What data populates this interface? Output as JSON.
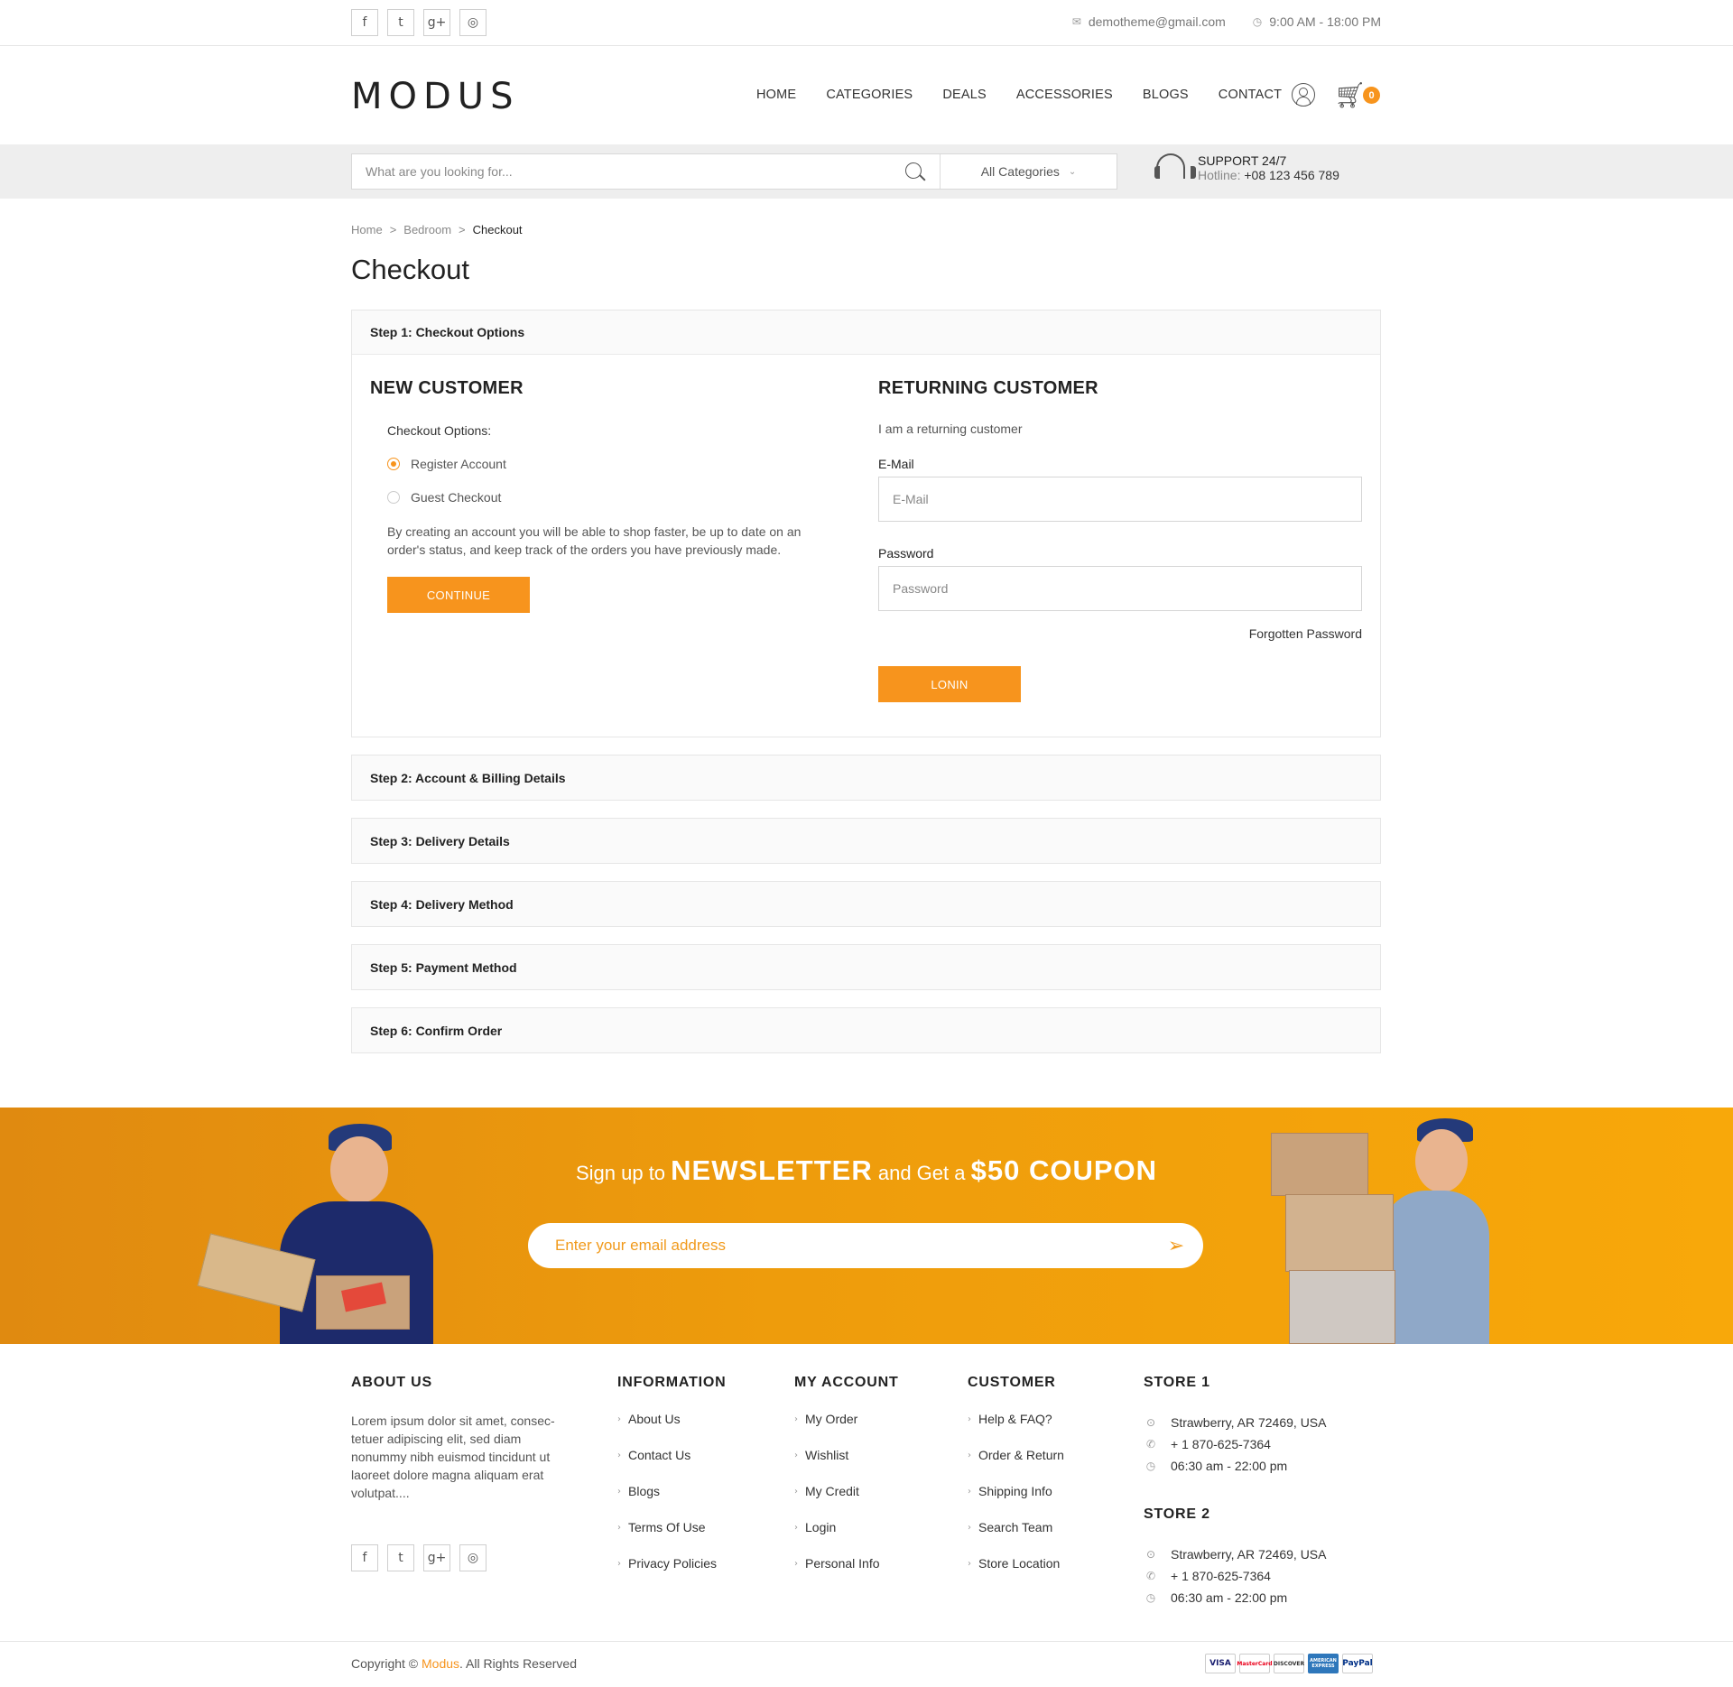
{
  "topbar": {
    "social_icons": [
      "f",
      "t",
      "g+",
      "◎"
    ],
    "email": "demotheme@gmail.com",
    "hours": "9:00 AM - 18:00 PM"
  },
  "header": {
    "logo": "MODUS",
    "nav": [
      "HOME",
      "CATEGORIES",
      "DEALS",
      "ACCESSORIES",
      "BLOGS",
      "CONTACT"
    ],
    "cart_count": "0"
  },
  "search": {
    "placeholder": "What are you looking for...",
    "category": "All Categories",
    "support_title": "SUPPORT 24/7",
    "hotline_label": "Hotline:",
    "hotline": "+08 123 456 789"
  },
  "breadcrumb": [
    "Home",
    "Bedroom",
    "Checkout"
  ],
  "page_title": "Checkout",
  "steps": [
    "Step 1: Checkout Options",
    "Step 2: Account & Billing Details",
    "Step 3: Delivery Details",
    "Step 4: Delivery Method",
    "Step 5: Payment Method",
    "Step 6: Confirm Order"
  ],
  "new_customer": {
    "title": "NEW CUSTOMER",
    "options_label": "Checkout Options:",
    "option_register": "Register Account",
    "option_guest": "Guest Checkout",
    "selected": "Register Account",
    "description": "By creating an account you will be able to shop faster, be up to date on an order's status, and keep track of the orders you have previously made.",
    "button": "CONTINUE"
  },
  "returning_customer": {
    "title": "RETURNING CUSTOMER",
    "subtitle": "I am a returning customer",
    "email_label": "E-Mail",
    "email_placeholder": "E-Mail",
    "password_label": "Password",
    "password_placeholder": "Password",
    "forgot": "Forgotten Password",
    "button": "LONIN"
  },
  "newsletter": {
    "pre": "Sign up to",
    "highlight1": "NEWSLETTER",
    "mid": "and Get a",
    "highlight2": "$50 COUPON",
    "placeholder": "Enter your email address"
  },
  "footer": {
    "about_title": "ABOUT US",
    "about_text": "Lorem ipsum dolor sit amet, consec-tetuer adipiscing elit, sed diam nonummy nibh euismod tincidunt ut laoreet dolore magna aliquam erat volutpat....",
    "information_title": "INFORMATION",
    "information": [
      "About Us",
      "Contact Us",
      "Blogs",
      "Terms Of Use",
      "Privacy Policies"
    ],
    "account_title": "MY ACCOUNT",
    "account": [
      "My Order",
      "Wishlist",
      "My Credit",
      "Login",
      "Personal Info"
    ],
    "customer_title": "CUSTOMER",
    "customer": [
      "Help & FAQ?",
      "Order & Return",
      "Shipping Info",
      "Search Team",
      "Store Location"
    ],
    "store1_title": "STORE 1",
    "store2_title": "STORE 2",
    "store_address": "Strawberry, AR 72469, USA",
    "store_phone": "+ 1 870-625-7364",
    "store_hours": "06:30 am - 22:00 pm",
    "copyright_pre": "Copyright ©",
    "copyright_brand": "Modus",
    "copyright_post": ". All Rights Reserved",
    "payment_cards": [
      "VISA",
      "MasterCard",
      "DISCOVER",
      "AMERICAN EXPRESS",
      "PayPal"
    ]
  },
  "colors": {
    "accent": "#f7941d",
    "newsletter_start": "#e08a10",
    "newsletter_end": "#f8a80a"
  }
}
